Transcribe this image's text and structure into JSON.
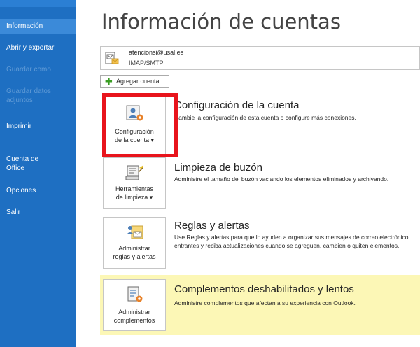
{
  "sidebar": {
    "items": [
      {
        "label": "Información",
        "state": "active"
      },
      {
        "label": "Abrir y exportar",
        "state": "normal"
      },
      {
        "label": "Guardar como",
        "state": "disabled"
      },
      {
        "label": "Guardar datos adjuntos",
        "state": "disabled"
      },
      {
        "label": "Imprimir",
        "state": "normal"
      },
      {
        "label": "Cuenta de Office",
        "state": "normal"
      },
      {
        "label": "Opciones",
        "state": "normal"
      },
      {
        "label": "Salir",
        "state": "normal"
      }
    ]
  },
  "page": {
    "title": "Información de cuentas"
  },
  "account": {
    "email": "atencionsi@usal.es",
    "type": "IMAP/SMTP"
  },
  "add_account": {
    "label": "Agregar cuenta"
  },
  "sections": [
    {
      "tile_label_1": "Configuración",
      "tile_label_2": "de la cuenta ▾",
      "title": "Configuración de la cuenta",
      "desc": "Cambie la configuración de esta cuenta o configure más conexiones."
    },
    {
      "tile_label_1": "Herramientas",
      "tile_label_2": "de limpieza ▾",
      "title": "Limpieza de buzón",
      "desc": "Administre el tamaño del buzón vaciando los elementos eliminados y archivando."
    },
    {
      "tile_label_1": "Administrar",
      "tile_label_2": "reglas y alertas",
      "title": "Reglas y alertas",
      "desc": "Use Reglas y alertas para que lo ayuden a organizar sus mensajes de correo electrónico entrantes y reciba actualizaciones cuando se agreguen, cambien o quiten elementos."
    },
    {
      "tile_label_1": "Administrar",
      "tile_label_2": "complementos",
      "title": "Complementos deshabilitados y lentos",
      "desc": "Administre complementos que afectan a su experiencia con Outlook."
    }
  ],
  "colors": {
    "sidebar": "#1e6fc2",
    "highlight": "#e8141c",
    "addins_band": "#fcf7b6"
  }
}
